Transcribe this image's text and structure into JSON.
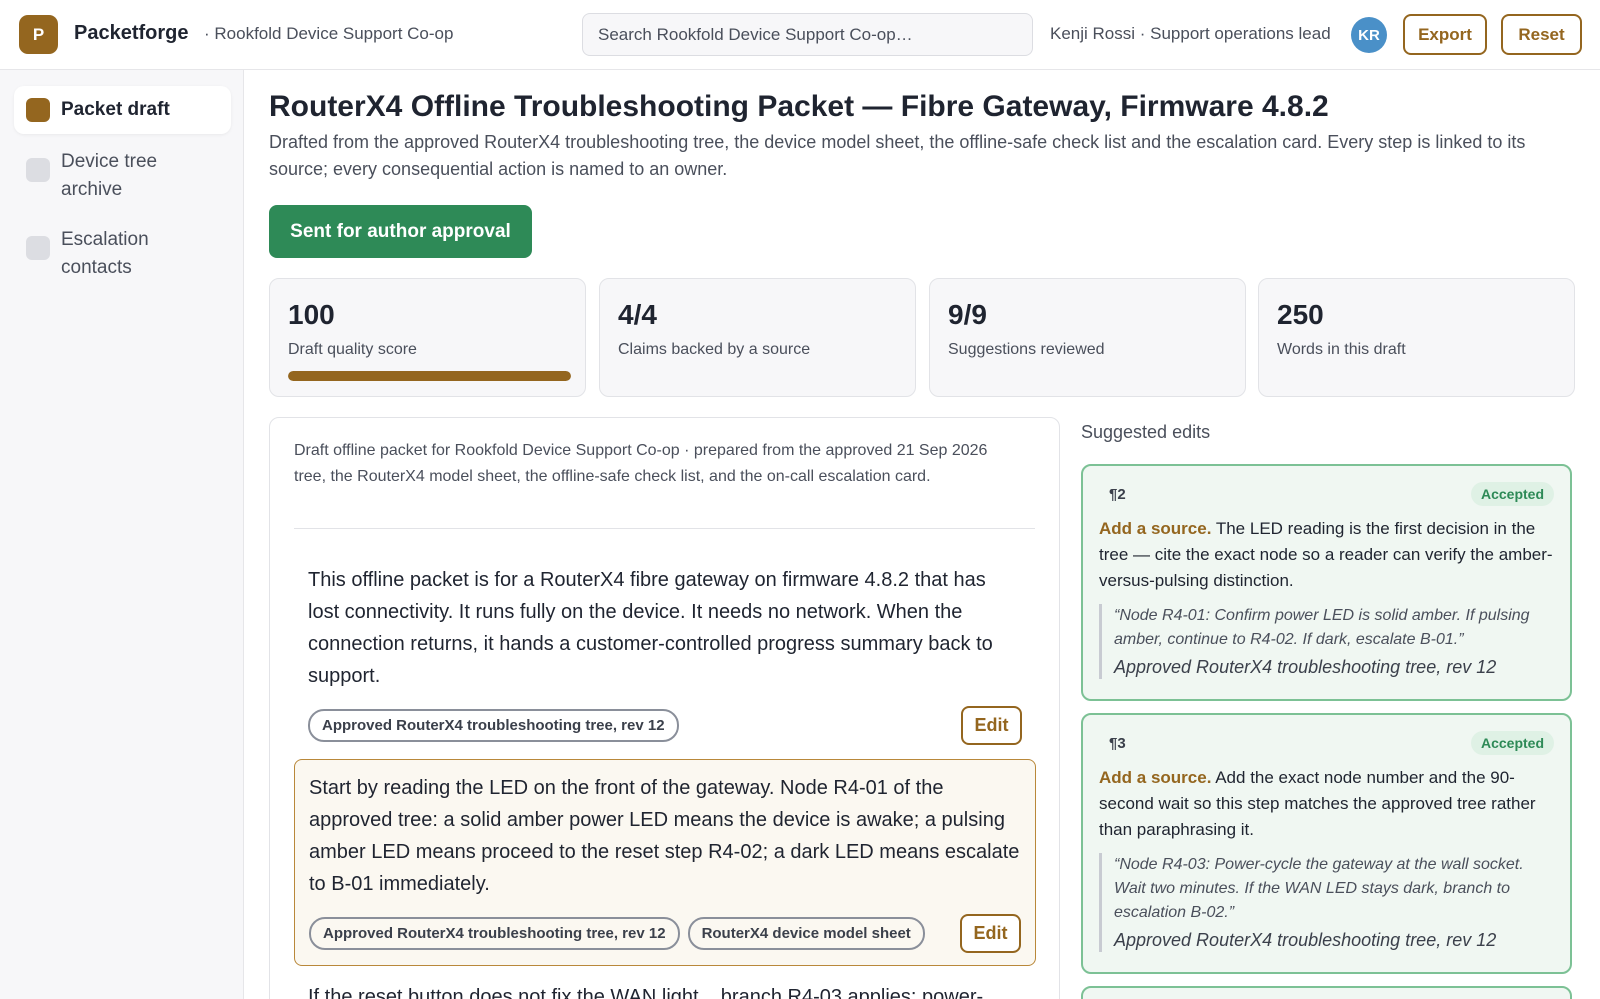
{
  "header": {
    "logo_letter": "P",
    "app_name": "Packetforge",
    "org": "· Rookfold Device Support Co-op",
    "search_placeholder": "Search Rookfold Device Support Co-op…",
    "user": "Kenji Rossi · Support operations lead",
    "avatar_initials": "KR",
    "export_label": "Export",
    "reset_label": "Reset"
  },
  "sidebar": {
    "items": [
      {
        "label": "Packet draft",
        "active": true
      },
      {
        "label": "Device tree archive",
        "active": false
      },
      {
        "label": "Escalation contacts",
        "active": false
      }
    ]
  },
  "main": {
    "title": "RouterX4 Offline Troubleshooting Packet — Fibre Gateway, Firmware 4.8.2",
    "subtitle": "Drafted from the approved RouterX4 troubleshooting tree, the device model sheet, the offline-safe check list and the escalation card. Every step is linked to its source; every consequential action is named to an owner.",
    "status_button": "Sent for author approval",
    "stats": [
      {
        "value": "100",
        "label": "Draft quality score",
        "progress": 1.0
      },
      {
        "value": "4/4",
        "label": "Claims backed by a source"
      },
      {
        "value": "9/9",
        "label": "Suggestions reviewed"
      },
      {
        "value": "250",
        "label": "Words in this draft"
      }
    ]
  },
  "draft": {
    "intro": "Draft offline packet for Rookfold Device Support Co-op · prepared from the approved 21 Sep 2026 tree, the RouterX4 model sheet, the offline-safe check list, and the on-call escalation card.",
    "paragraphs": [
      {
        "text": "This offline packet is for a RouterX4 fibre gateway on firmware 4.8.2 that has lost connectivity. It runs fully on the device. It needs no network. When the connection returns, it hands a customer-controlled progress summary back to support.",
        "tags": [
          "Approved RouterX4 troubleshooting tree, rev 12"
        ],
        "edit_label": "Edit"
      },
      {
        "text": "Start by reading the LED on the front of the gateway. Node R4-01 of the approved tree: a solid amber power LED means the device is awake; a pulsing amber LED means proceed to the reset step R4-02; a dark LED means escalate to B-01 immediately.",
        "tags": [
          "Approved RouterX4 troubleshooting tree, rev 12",
          "RouterX4 device model sheet"
        ],
        "edit_label": "Edit"
      },
      {
        "text": "If the reset button does not fix the WAN light, , branch R4-03 applies: power-"
      }
    ]
  },
  "suggestions": {
    "heading": "Suggested edits",
    "items": [
      {
        "para": "¶2",
        "status": "Accepted",
        "kind": "Add a source.",
        "body": "The LED reading is the first decision in the tree — cite the exact node so a reader can verify the amber-versus-pulsing distinction.",
        "quote": "“Node R4-01: Confirm power LED is solid amber. If pulsing amber, continue to R4-02. If dark, escalate B-01.”",
        "source": "Approved RouterX4 troubleshooting tree, rev 12"
      },
      {
        "para": "¶3",
        "status": "Accepted",
        "kind": "Add a source.",
        "body": "Add the exact node number and the 90-second wait so this step matches the approved tree rather than paraphrasing it.",
        "quote": "“Node R4-03: Power-cycle the gateway at the wall socket. Wait two minutes. If the WAN LED stays dark, branch to escalation B-02.”",
        "source": "Approved RouterX4 troubleshooting tree, rev 12"
      }
    ]
  }
}
